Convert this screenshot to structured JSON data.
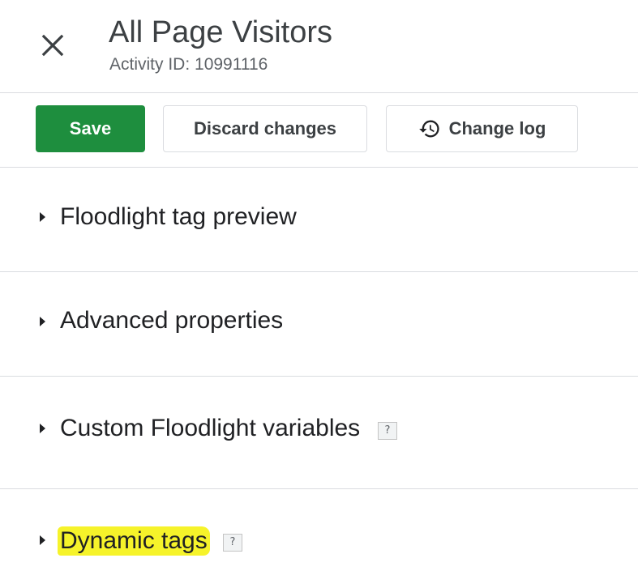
{
  "header": {
    "title": "All Page Visitors",
    "subtitle": "Activity ID: 10991116",
    "close_icon": "close-icon"
  },
  "toolbar": {
    "save_label": "Save",
    "discard_label": "Discard changes",
    "changelog_label": "Change log",
    "changelog_icon": "history-icon",
    "save_color": "#1e8e3e"
  },
  "sections": [
    {
      "label": "Floodlight tag preview",
      "has_help": false
    },
    {
      "label": "Advanced properties",
      "has_help": false
    },
    {
      "label": "Custom Floodlight variables",
      "has_help": true,
      "help": "?"
    },
    {
      "label": "Dynamic tags",
      "has_help": true,
      "help": "?",
      "highlighted": true,
      "highlight_color": "#f6f32a"
    }
  ]
}
